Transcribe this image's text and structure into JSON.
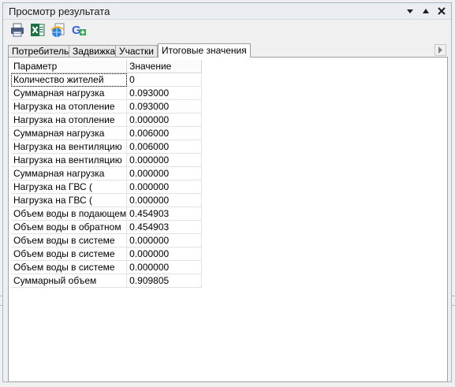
{
  "window": {
    "title": "Просмотр результата"
  },
  "toolbar": {
    "tools": [
      {
        "icon": "print-icon"
      },
      {
        "icon": "excel-export-icon"
      },
      {
        "icon": "web-export-icon"
      },
      {
        "icon": "google-add-icon"
      }
    ]
  },
  "tabs": [
    {
      "label": "Потребитель",
      "active": false
    },
    {
      "label": "Задвижка",
      "active": false
    },
    {
      "label": "Участки",
      "active": false
    },
    {
      "label": "Итоговые значения",
      "active": true
    }
  ],
  "table": {
    "headers": {
      "param": "Параметр",
      "value": "Значение"
    },
    "rows": [
      {
        "param": "Количество жителей",
        "value": "0"
      },
      {
        "param": "Суммарная нагрузка",
        "value": "0.093000"
      },
      {
        "param": "Нагрузка на отопление",
        "value": "0.093000"
      },
      {
        "param": "Нагрузка на отопление",
        "value": "0.000000"
      },
      {
        "param": "Суммарная нагрузка",
        "value": "0.006000"
      },
      {
        "param": "Нагрузка на вентиляцию",
        "value": "0.006000"
      },
      {
        "param": "Нагрузка на вентиляцию",
        "value": "0.000000"
      },
      {
        "param": "Суммарная нагрузка",
        "value": "0.000000"
      },
      {
        "param": "Нагрузка на ГВС (",
        "value": "0.000000"
      },
      {
        "param": "Нагрузка на ГВС (",
        "value": "0.000000"
      },
      {
        "param": "Объем воды в подающем",
        "value": "0.454903"
      },
      {
        "param": "Объем воды в обратном",
        "value": "0.454903"
      },
      {
        "param": "Объем воды в системе",
        "value": "0.000000"
      },
      {
        "param": "Объем воды в системе",
        "value": "0.000000"
      },
      {
        "param": "Объем воды в системе",
        "value": "0.000000"
      },
      {
        "param": "Суммарный объем",
        "value": "0.909805"
      }
    ]
  }
}
